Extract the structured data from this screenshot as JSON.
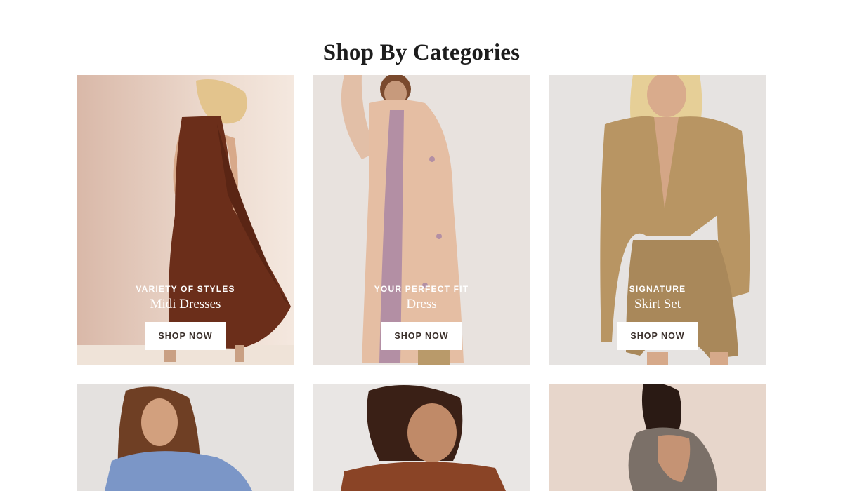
{
  "section": {
    "title": "Shop By Categories"
  },
  "cards": [
    {
      "eyebrow": "VARIETY OF STYLES",
      "title": "Midi Dresses",
      "cta": "SHOP NOW"
    },
    {
      "eyebrow": "YOUR PERFECT FIT",
      "title": "Dress",
      "cta": "SHOP NOW"
    },
    {
      "eyebrow": "SIGNATURE",
      "title": "Skirt Set",
      "cta": "SHOP NOW"
    },
    {
      "eyebrow": "",
      "title": "",
      "cta": ""
    },
    {
      "eyebrow": "",
      "title": "",
      "cta": ""
    },
    {
      "eyebrow": "",
      "title": "",
      "cta": ""
    }
  ],
  "colors": {
    "text": "#1d1d1d",
    "button_bg": "#ffffff",
    "button_text": "#3a2f2a"
  }
}
